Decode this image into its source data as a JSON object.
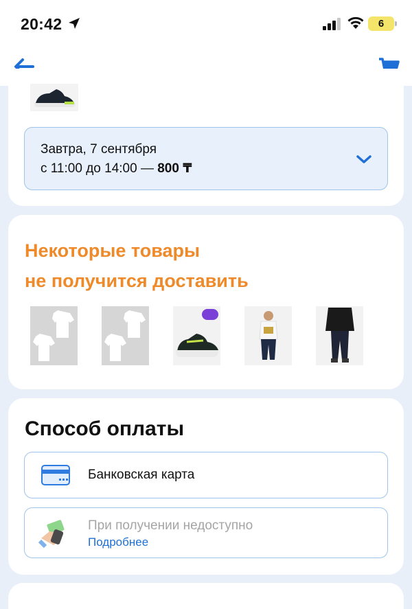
{
  "status": {
    "time": "20:42",
    "battery": "6"
  },
  "nav": {
    "back_icon": "arrow-left-icon",
    "cart_icon": "cart-icon"
  },
  "delivery": {
    "slot_date": "Завтра, 7 сентября",
    "slot_time": "с 11:00 до 14:00 — ",
    "slot_price": "800 ₸"
  },
  "unavailable": {
    "title_line1": "Некоторые товары",
    "title_line2": "не получится доставить",
    "products": [
      "t-shirts-white",
      "t-shirts-white",
      "sneakers",
      "outfit-kid",
      "outfit-kid-dark"
    ]
  },
  "payment": {
    "title": "Способ оплаты",
    "card_label": "Банковская карта",
    "cod_label": "При получении недоступно",
    "cod_more": "Подробнее"
  },
  "colors": {
    "accent_orange": "#ef8a2b",
    "link_blue": "#1e6fd6",
    "border_blue": "#9ec3ec",
    "page_bg": "#e9eff8"
  }
}
